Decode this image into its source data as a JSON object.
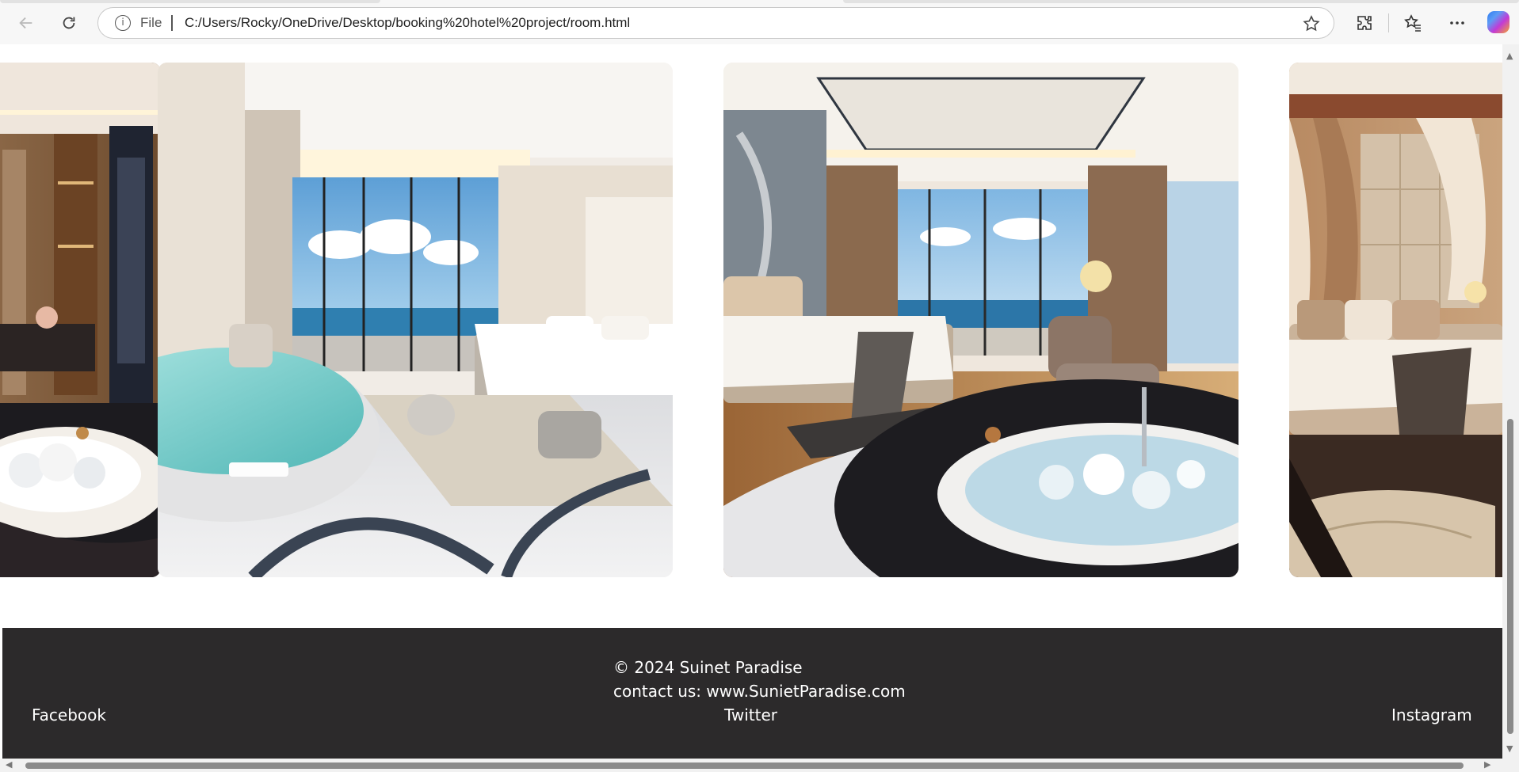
{
  "browser": {
    "url": "C:/Users/Rocky/OneDrive/Desktop/booking%20hotel%20project/room.html",
    "scheme_label": "File",
    "icons": {
      "back": "back-arrow-icon",
      "reload": "reload-icon",
      "info": "info-icon",
      "favorite": "star-icon",
      "extensions": "puzzle-icon",
      "favorites": "favorites-icon",
      "more": "more-icon",
      "copilot": "copilot-icon"
    }
  },
  "gallery": {
    "images": [
      {
        "alt": "Luxury room with bathtub and wooden shelves"
      },
      {
        "alt": "Bright suite with round jacuzzi and ocean view"
      },
      {
        "alt": "Suite with dark marble jacuzzi and sea view"
      },
      {
        "alt": "Warm toned bedroom with drapes"
      }
    ]
  },
  "footer": {
    "copyright": "© 2024 Suinet Paradise",
    "contact": "contact us: www.SunietParadise.com",
    "facebook": "Facebook",
    "twitter": "Twitter",
    "instagram": "Instagram",
    "background": "#2c2a2b"
  }
}
